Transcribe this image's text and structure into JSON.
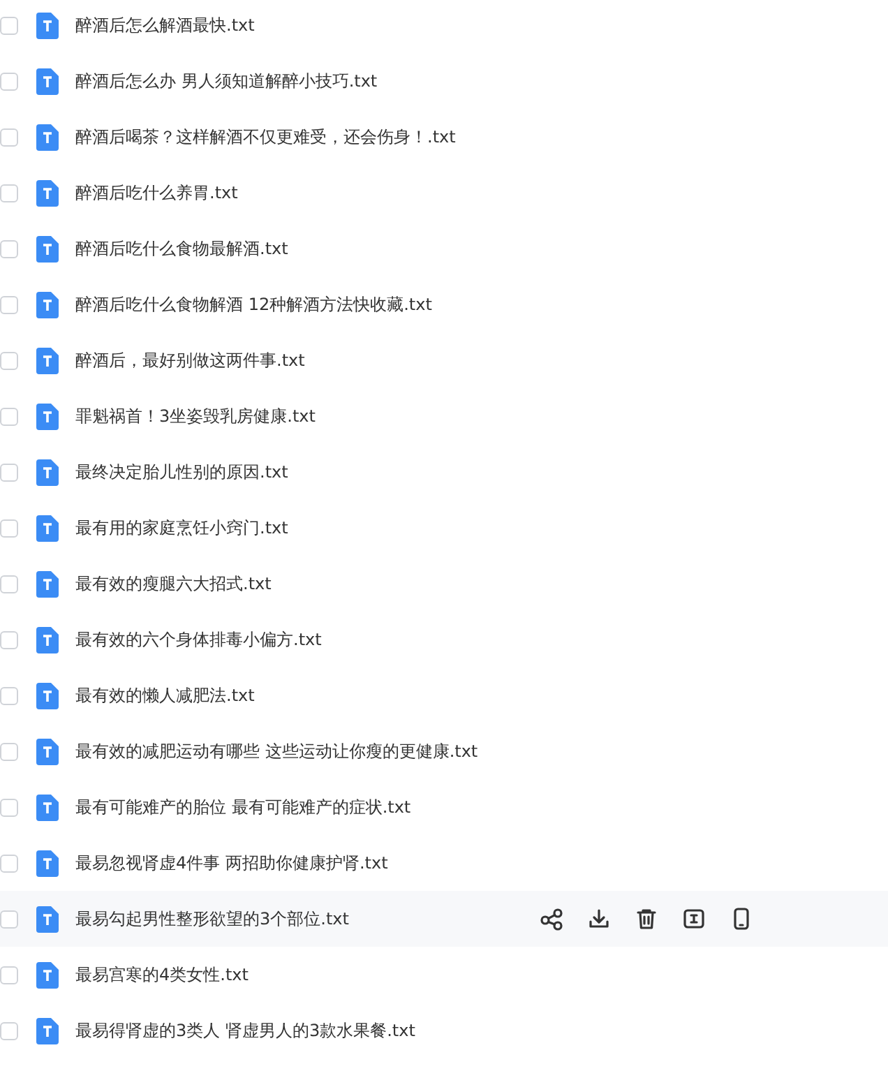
{
  "files": [
    {
      "name": "醉酒后怎么解酒最快.txt",
      "checked": false,
      "hovered": false
    },
    {
      "name": "醉酒后怎么办 男人须知道解醉小技巧.txt",
      "checked": false,
      "hovered": false
    },
    {
      "name": "醉酒后喝茶？这样解酒不仅更难受，还会伤身！.txt",
      "checked": false,
      "hovered": false
    },
    {
      "name": "醉酒后吃什么养胃.txt",
      "checked": false,
      "hovered": false
    },
    {
      "name": "醉酒后吃什么食物最解酒.txt",
      "checked": false,
      "hovered": false
    },
    {
      "name": "醉酒后吃什么食物解酒 12种解酒方法快收藏.txt",
      "checked": false,
      "hovered": false
    },
    {
      "name": "醉酒后，最好别做这两件事.txt",
      "checked": false,
      "hovered": false
    },
    {
      "name": "罪魁祸首！3坐姿毁乳房健康.txt",
      "checked": false,
      "hovered": false
    },
    {
      "name": "最终决定胎儿性别的原因.txt",
      "checked": false,
      "hovered": false
    },
    {
      "name": "最有用的家庭烹饪小窍门.txt",
      "checked": false,
      "hovered": false
    },
    {
      "name": "最有效的瘦腿六大招式.txt",
      "checked": false,
      "hovered": false
    },
    {
      "name": "最有效的六个身体排毒小偏方.txt",
      "checked": false,
      "hovered": false
    },
    {
      "name": "最有效的懒人减肥法.txt",
      "checked": false,
      "hovered": false
    },
    {
      "name": "最有效的减肥运动有哪些 这些运动让你瘦的更健康.txt",
      "checked": false,
      "hovered": false
    },
    {
      "name": "最有可能难产的胎位 最有可能难产的症状.txt",
      "checked": false,
      "hovered": false
    },
    {
      "name": "最易忽视肾虚4件事 两招助你健康护肾.txt",
      "checked": false,
      "hovered": false
    },
    {
      "name": "最易勾起男性整形欲望的3个部位.txt",
      "checked": false,
      "hovered": true
    },
    {
      "name": "最易宫寒的4类女性.txt",
      "checked": false,
      "hovered": false
    },
    {
      "name": "最易得肾虚的3类人 肾虚男人的3款水果餐.txt",
      "checked": false,
      "hovered": false
    }
  ]
}
